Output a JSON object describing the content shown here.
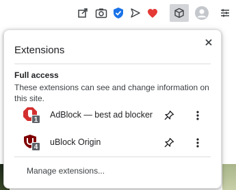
{
  "toolbar": {
    "icons": [
      "share-icon",
      "screenshot-icon",
      "shield-check-icon",
      "send-icon",
      "heart-icon",
      "extensions-puzzle-icon",
      "profile-avatar-icon",
      "menu-icon"
    ],
    "accent": "#1a73e8",
    "heart_color": "#e53935"
  },
  "popup": {
    "title": "Extensions",
    "close_icon": "close-icon",
    "section": {
      "title": "Full access",
      "description": "These extensions can see and change information on this site."
    },
    "extensions": [
      {
        "name": "AdBlock — best ad blocker",
        "badge": "1",
        "icon": "adblock-icon",
        "color": "#d32f2f"
      },
      {
        "name": "uBlock Origin",
        "badge": "4",
        "icon": "ublock-origin-icon",
        "color": "#800000"
      }
    ],
    "manage_label": "Manage extensions..."
  }
}
